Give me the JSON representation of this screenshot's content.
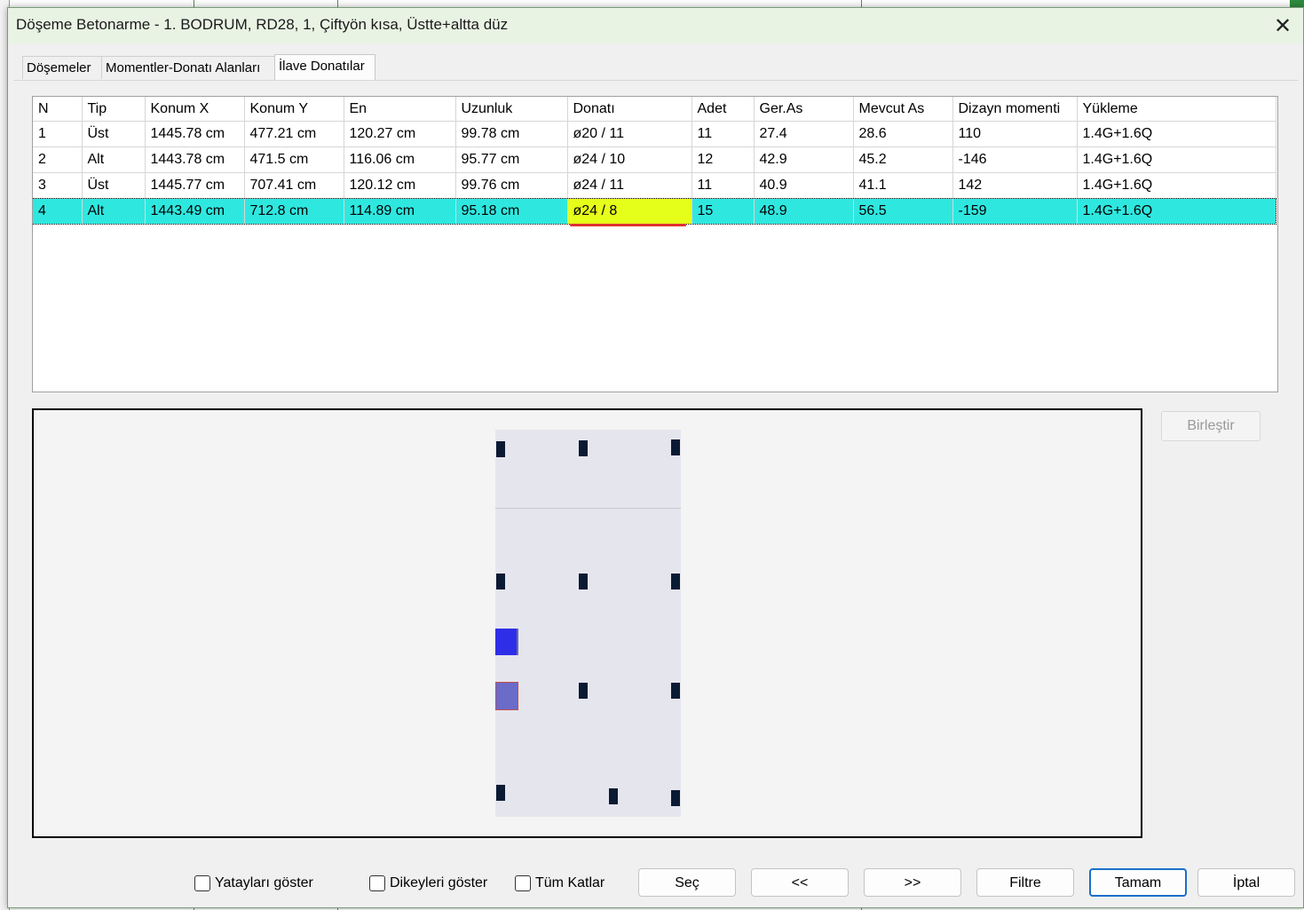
{
  "dialog": {
    "title": "Döşeme Betonarme - 1. BODRUM, RD28, 1, Çiftyön kısa, Üstte+altta düz",
    "close_label": "✕"
  },
  "tabs": [
    {
      "label": "Döşemeler"
    },
    {
      "label": "Momentler-Donatı Alanları"
    },
    {
      "label": "İlave Donatılar",
      "active": true
    }
  ],
  "table": {
    "columns": [
      "N",
      "Tip",
      "Konum X",
      "Konum Y",
      "En",
      "Uzunluk",
      "Donatı",
      "Adet",
      "Ger.As",
      "Mevcut As",
      "Dizayn momenti",
      "Yükleme"
    ],
    "rows": [
      [
        "1",
        "Üst",
        "1445.78 cm",
        "477.21 cm",
        "120.27 cm",
        "99.78 cm",
        "ø20 / 11",
        "11",
        "27.4",
        "28.6",
        "110",
        "1.4G+1.6Q"
      ],
      [
        "2",
        "Alt",
        "1443.78 cm",
        "471.5 cm",
        "116.06 cm",
        "95.77 cm",
        "ø24 / 10",
        "12",
        "42.9",
        "45.2",
        "-146",
        "1.4G+1.6Q"
      ],
      [
        "3",
        "Üst",
        "1445.77 cm",
        "707.41 cm",
        "120.12 cm",
        "99.76 cm",
        "ø24 / 11",
        "11",
        "40.9",
        "41.1",
        "142",
        "1.4G+1.6Q"
      ],
      [
        "4",
        "Alt",
        "1443.49 cm",
        "712.8 cm",
        "114.89 cm",
        "95.18 cm",
        "ø24 / 8",
        "15",
        "48.9",
        "56.5",
        "-159",
        "1.4G+1.6Q"
      ]
    ],
    "selected_row": 3
  },
  "side": {
    "merge_label": "Birleştir"
  },
  "bottom": {
    "show_horizontal_label": "Yatayları göster",
    "show_vertical_label": "Dikeyleri göster",
    "all_floors_label": "Tüm Katlar",
    "select_label": "Seç",
    "prev_label": "<<",
    "next_label": ">>",
    "filter_label": "Filtre",
    "ok_label": "Tamam",
    "cancel_label": "İptal"
  },
  "colors": {
    "selected_row": "#2ee8e0",
    "highlight_cell": "#e6ff1a",
    "ok_border": "#1a6fc9",
    "rebar_blue": "#2e2ee8"
  }
}
